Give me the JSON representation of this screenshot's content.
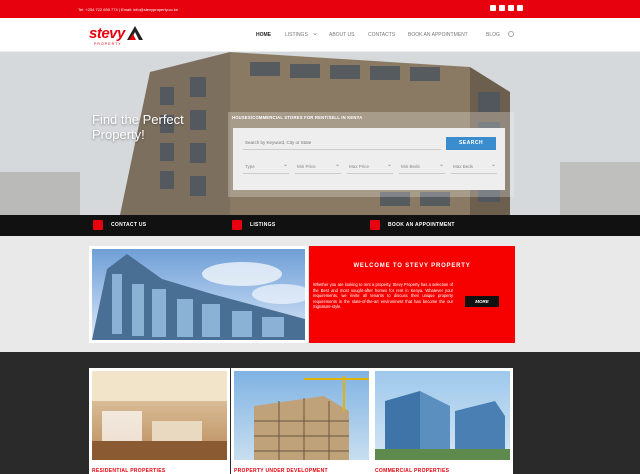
{
  "topbar": {
    "contact": "Tel: +254 722 690 774 | Email: info@stevyproperty.co.ke",
    "social": [
      "twitter-icon",
      "facebook-icon",
      "instagram-icon",
      "linkedin-icon"
    ]
  },
  "header": {
    "logo_word": "stevy",
    "logo_sub": "PROPERTY",
    "nav": [
      "HOME",
      "LISTINGS",
      "ABOUT US",
      "CONTACTS",
      "BOOK AN APPOINTMENT",
      "BLOG"
    ]
  },
  "hero": {
    "title": "Find the Perfect Property!",
    "panel_label": "HOUSES/COMMERCIAL STORES FOR RENT/SELL IN KENYA",
    "keyword_placeholder": "Search by Keyword, City or State",
    "search_label": "SEARCH",
    "filters": [
      "Type",
      "Min Price",
      "Max Price",
      "Min Beds",
      "Max Beds"
    ]
  },
  "cta": {
    "items": [
      "CONTACT US",
      "LISTINGS",
      "BOOK AN APPOINTMENT"
    ]
  },
  "welcome": {
    "title": "WELCOME TO STEVY PROPERTY",
    "body": "Whether you are looking to rent a property, Stevy Property has a selection of the Best and most sought-after homes for rent in Kenya. Whatever your requirements, we invite all tenants to discuss their unique property requirements in the state-of-the-art environment that has become the our Signature-style.",
    "more_label": "MORE"
  },
  "cards": [
    {
      "caption": "RESIDENTIAL PROPERTIES"
    },
    {
      "caption": "PROPERTY UNDER DEVELOPMENT"
    },
    {
      "caption": "COMMERCIAL PROPERTIES"
    }
  ],
  "colors": {
    "brand_red": "#e7000d",
    "search_blue": "#3b8ccc",
    "dark_band": "#111111"
  }
}
